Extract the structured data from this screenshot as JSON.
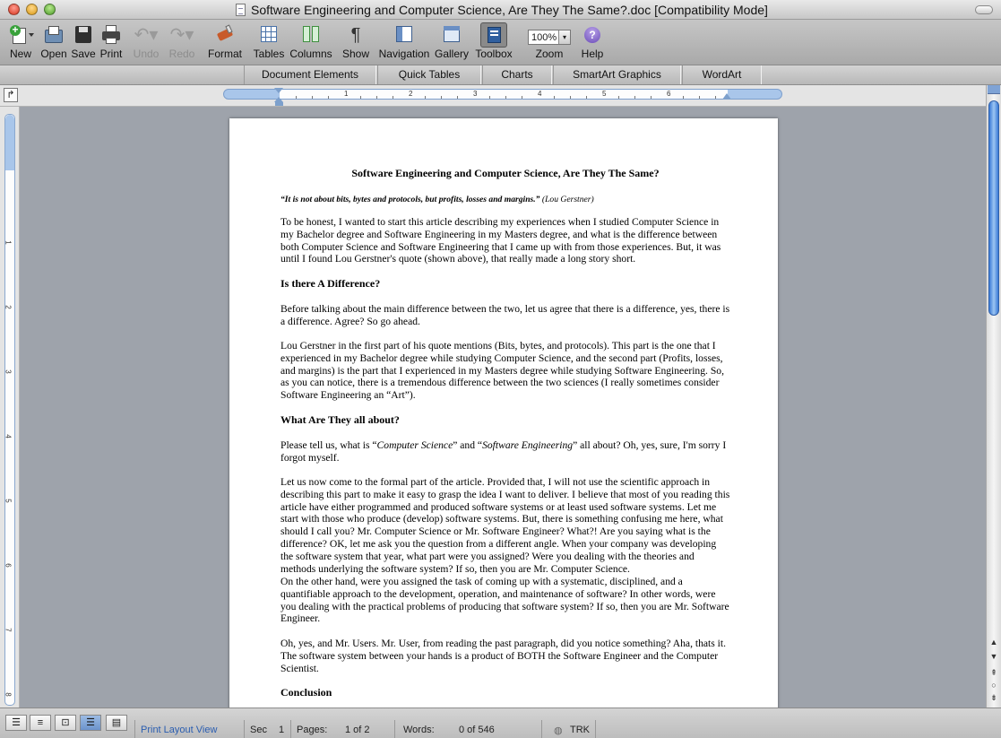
{
  "window": {
    "title": "Software Engineering and Computer Science, Are They The Same?.doc [Compatibility Mode]"
  },
  "toolbar": {
    "new": "New",
    "open": "Open",
    "save": "Save",
    "print": "Print",
    "undo": "Undo",
    "redo": "Redo",
    "format": "Format",
    "tables": "Tables",
    "columns": "Columns",
    "show": "Show",
    "navigation": "Navigation",
    "gallery": "Gallery",
    "toolbox": "Toolbox",
    "zoom_value": "100%",
    "zoom": "Zoom",
    "help": "Help"
  },
  "ribbon": {
    "tabs": [
      "Document Elements",
      "Quick Tables",
      "Charts",
      "SmartArt Graphics",
      "WordArt"
    ]
  },
  "ruler": {
    "h_numbers": [
      "1",
      "2",
      "3",
      "4",
      "5",
      "6"
    ],
    "v_numbers": [
      "1",
      "2",
      "3",
      "4",
      "5",
      "6",
      "7",
      "8"
    ]
  },
  "document": {
    "title": "Software Engineering and Computer Science, Are They The Same?",
    "quote": "“It is not about bits, bytes and protocols, but profits, losses and margins.”",
    "quote_author": "(Lou Gerstner)",
    "p1": "To be honest, I wanted to start this article describing my experiences when I studied Computer Science in my Bachelor degree and Software Engineering in my Masters degree, and what is the difference between both Computer Science and Software Engineering that I came up with from those experiences. But, it was until I found Lou Gerstner's quote (shown above), that really made a long story short.",
    "h1": "Is there A Difference?",
    "p2": "Before talking about the main difference between the two, let us agree that there is a difference, yes, there is a difference. Agree? So go ahead.",
    "p3": "Lou Gerstner in the first part of his quote mentions (Bits, bytes, and protocols). This part is the one that I experienced in my Bachelor degree while studying Computer Science, and the second part (Profits, losses, and margins) is the part that I experienced in my Masters degree while studying Software Engineering. So, as you can notice, there is a tremendous difference between the two sciences (I really sometimes consider Software Engineering an “Art”).",
    "h2": "What Are They all about?",
    "p4_a": "Please tell us, what is “",
    "p4_cs": "Computer Science",
    "p4_b": "” and “",
    "p4_se": "Software Engineering",
    "p4_c": "” all about? Oh, yes, sure, I'm sorry I forgot myself.",
    "p5": "Let us now come to the formal part of the article. Provided that, I will not use the scientific approach in describing this part to make it easy to grasp the idea I want to deliver. I believe that most of you reading this article have either programmed and produced software systems or at least used software systems. Let me start with those who produce (develop) software systems. But, there is something confusing me here, what should I call you? Mr. Computer Science or Mr. Software Engineer? What?! Are you saying what is the difference? OK, let me ask you the question from a different angle. When your company was developing the software system that year, what part were you assigned? Were you dealing with the theories and methods underlying the software system? If so, then you are Mr. Computer Science.",
    "p6": "On the other hand, were you assigned the task of coming up with a systematic, disciplined, and a quantifiable approach to the development, operation, and maintenance of software? In other words, were you dealing with the practical problems of producing that software system? If so, then you are Mr. Software Engineer.",
    "p7": "Oh, yes, and Mr. Users. Mr. User, from reading the past paragraph, did you notice something? Aha, thats it. The software system between your hands is a product of BOTH the Software Engineer and the Computer Scientist.",
    "h3": "Conclusion"
  },
  "status": {
    "view": "Print Layout View",
    "sec_label": "Sec",
    "sec_value": "1",
    "pages_label": "Pages:",
    "pages_value": "1 of 2",
    "words_label": "Words:",
    "words_value": "0 of 546",
    "trk": "TRK"
  }
}
